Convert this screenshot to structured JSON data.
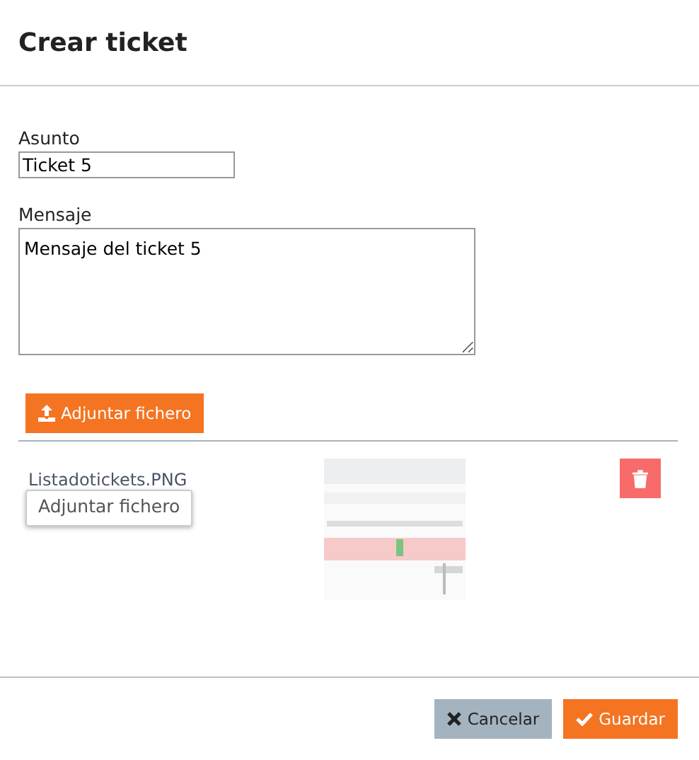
{
  "dialog": {
    "title": "Crear ticket"
  },
  "fields": [
    {
      "kind": "input",
      "label": "Asunto",
      "value": "Ticket 5"
    },
    {
      "kind": "textarea",
      "label": "Mensaje",
      "value": "Mensaje del ticket 5"
    }
  ],
  "attach_button": "Adjuntar fichero",
  "attachments": [
    {
      "file_name": "Listadotickets.PNG"
    }
  ],
  "tooltip": "Adjuntar fichero",
  "buttons": [
    {
      "kind": "cancel",
      "label": "Cancelar"
    },
    {
      "kind": "save",
      "label": "Guardar"
    }
  ]
}
